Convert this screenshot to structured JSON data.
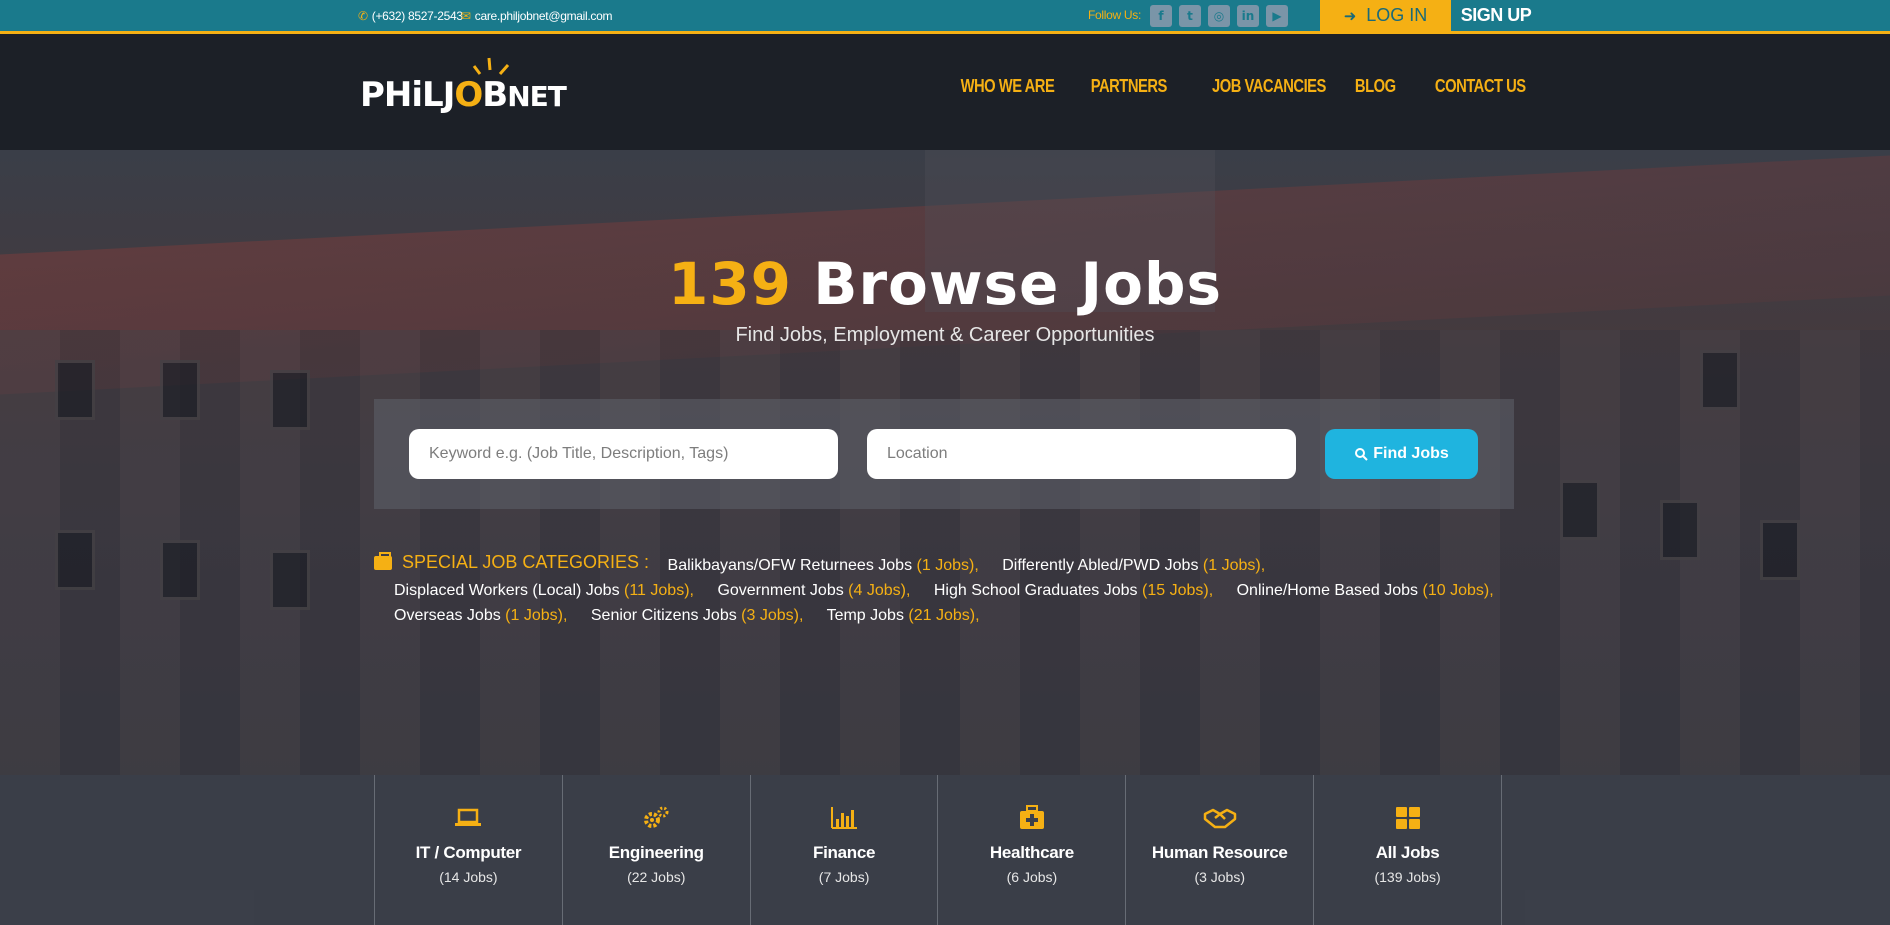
{
  "topbar": {
    "phone": "(+632) 8527-2543",
    "email": "care.philjobnet@gmail.com",
    "follow_label": "Follow Us:",
    "socials": [
      "facebook-icon",
      "twitter-icon",
      "instagram-icon",
      "linkedin-icon",
      "youtube-icon"
    ],
    "login_label": "LOG IN",
    "signup_label": "SIGN UP"
  },
  "header": {
    "logo": {
      "part1": "PHiL",
      "part2": "J",
      "part3": "O",
      "part4": "B",
      "part5": "NET"
    },
    "nav": [
      "WHO WE ARE",
      "PARTNERS",
      "JOB VACANCIES",
      "BLOG",
      "CONTACT US"
    ]
  },
  "hero": {
    "count": "139",
    "title": "Browse Jobs",
    "subtitle": "Find Jobs, Employment & Career Opportunities"
  },
  "search": {
    "keyword_placeholder": "Keyword e.g. (Job Title, Description, Tags)",
    "location_placeholder": "Location",
    "button_label": "Find Jobs"
  },
  "special": {
    "heading": "SPECIAL JOB CATEGORIES :",
    "items": [
      {
        "name": "Balikbayans/OFW Returnees Jobs",
        "count": "(1 Jobs)"
      },
      {
        "name": "Differently Abled/PWD Jobs",
        "count": "(1 Jobs)"
      },
      {
        "name": "Displaced Workers (Local) Jobs",
        "count": "(11 Jobs)"
      },
      {
        "name": "Government Jobs",
        "count": "(4 Jobs)"
      },
      {
        "name": "High School Graduates Jobs",
        "count": "(15 Jobs)"
      },
      {
        "name": "Online/Home Based Jobs",
        "count": "(10 Jobs)"
      },
      {
        "name": "Overseas Jobs",
        "count": "(1 Jobs)"
      },
      {
        "name": "Senior Citizens Jobs",
        "count": "(3 Jobs)"
      },
      {
        "name": "Temp Jobs",
        "count": "(21 Jobs)"
      }
    ]
  },
  "categories": [
    {
      "name": "IT / Computer",
      "count": "(14 Jobs)",
      "icon": "laptop-icon"
    },
    {
      "name": "Engineering",
      "count": "(22 Jobs)",
      "icon": "gears-icon"
    },
    {
      "name": "Finance",
      "count": "(7 Jobs)",
      "icon": "bar-chart-icon"
    },
    {
      "name": "Healthcare",
      "count": "(6 Jobs)",
      "icon": "medkit-icon"
    },
    {
      "name": "Human Resource",
      "count": "(3 Jobs)",
      "icon": "handshake-icon"
    },
    {
      "name": "All Jobs",
      "count": "(139 Jobs)",
      "icon": "grid-icon"
    }
  ],
  "colors": {
    "accent": "#f5b014",
    "teal": "#1a7a8c",
    "button": "#1fb4df"
  }
}
